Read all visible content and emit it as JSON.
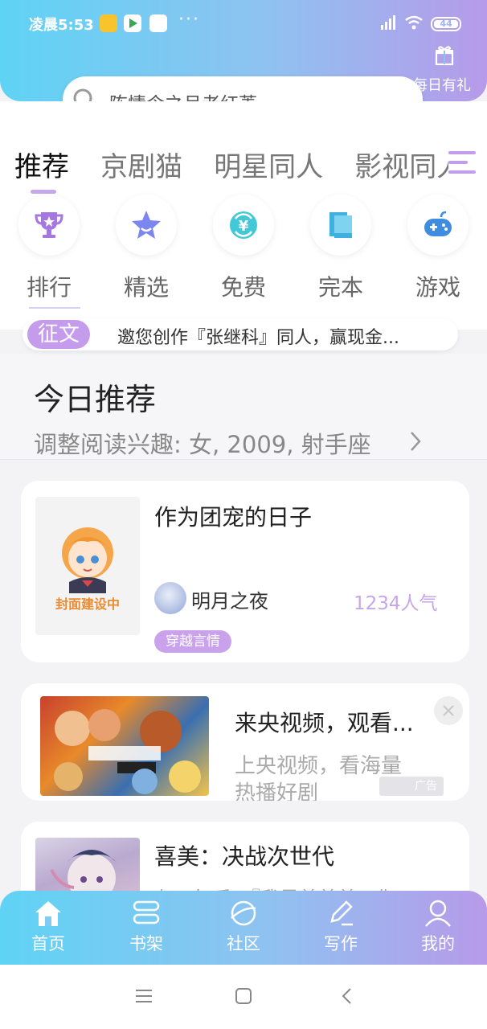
{
  "status_bar": {
    "time": "凌晨5:53",
    "dots": "···",
    "battery": "44"
  },
  "header": {
    "gift_label": "每日有礼"
  },
  "search": {
    "placeholder": "陈情令之月老红菱"
  },
  "tabs": [
    {
      "label": "推荐",
      "active": true
    },
    {
      "label": "京剧猫",
      "active": false
    },
    {
      "label": "明星同人",
      "active": false
    },
    {
      "label": "影视同人",
      "active": false
    }
  ],
  "quick_links": [
    {
      "label": "排行",
      "icon": "trophy-icon"
    },
    {
      "label": "精选",
      "icon": "star-icon"
    },
    {
      "label": "免费",
      "icon": "yuan-icon"
    },
    {
      "label": "完本",
      "icon": "book-icon"
    },
    {
      "label": "游戏",
      "icon": "gamepad-icon"
    }
  ],
  "notice": {
    "badge": "征文",
    "text": "邀您创作『张继科』同人，赢现金..."
  },
  "today": {
    "title": "今日推荐",
    "subtitle": "调整阅读兴趣: 女, 2009, 射手座"
  },
  "cards": {
    "book1": {
      "title": "作为团宠的日子",
      "cover_label": "封面建设中",
      "author": "明月之夜",
      "popularity": "1234人气",
      "tag": "穿越言情"
    },
    "ad": {
      "title": "来央视频，观看...",
      "desc": "上央视频，看海量热播好剧",
      "badge": "广告"
    },
    "book2": {
      "title": "喜美：决战次世代",
      "desc": "七五午后，『我是美美美，你"
    }
  },
  "bottom_nav": [
    {
      "label": "首页",
      "icon": "home-icon",
      "active": true
    },
    {
      "label": "书架",
      "icon": "bookshelf-icon",
      "active": false
    },
    {
      "label": "社区",
      "icon": "planet-icon",
      "active": false
    },
    {
      "label": "写作",
      "icon": "pen-icon",
      "active": false
    },
    {
      "label": "我的",
      "icon": "user-icon",
      "active": false
    }
  ],
  "colors": {
    "gradient_start": "#5fd3f4",
    "gradient_end": "#b79ae9",
    "accent_purple": "#c59bec"
  }
}
